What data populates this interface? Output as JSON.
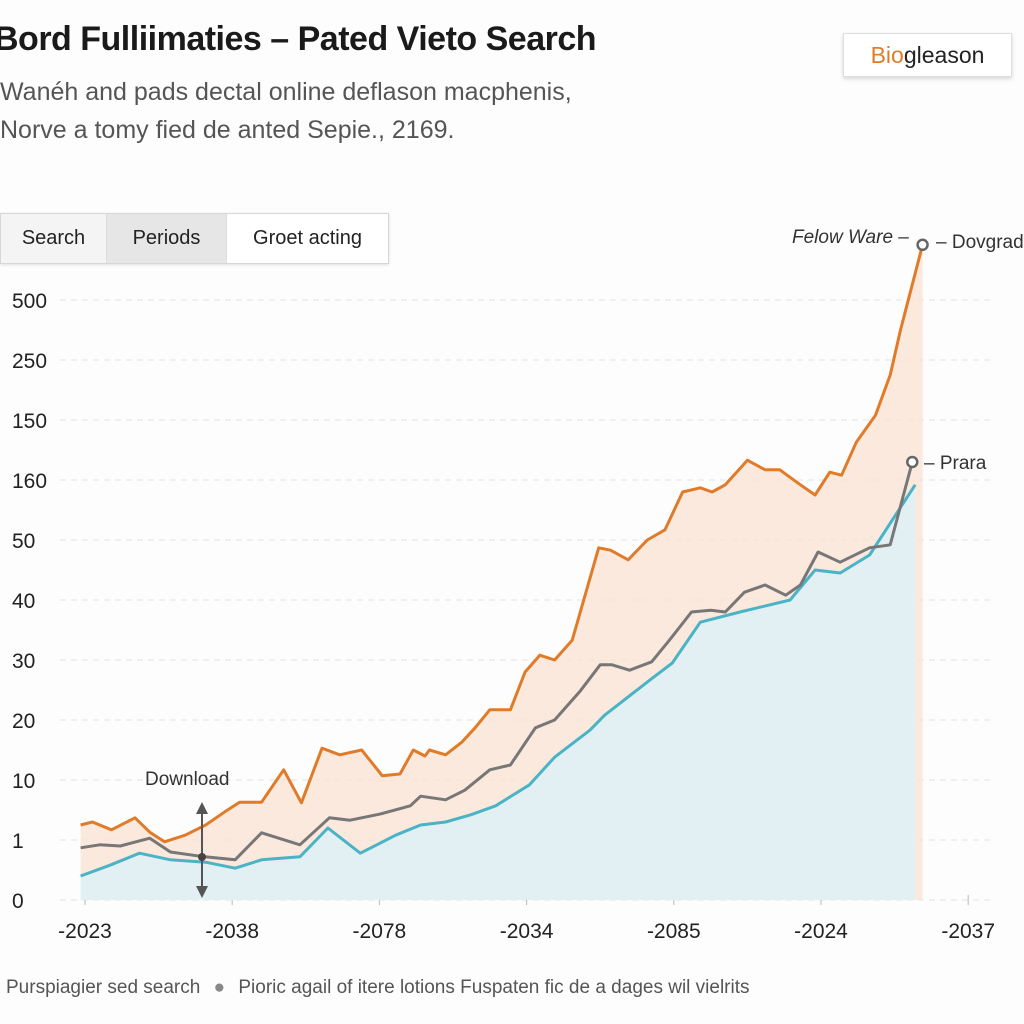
{
  "header": {
    "title": "Bord Fulliimaties – Pated Vieto Search",
    "subtitle_line1": "Wanéh and pads dectal online deflason macphenis,",
    "subtitle_line2": "Norve a tomy fied de anted Sepie., 2169.",
    "brand_prefix": "Bio",
    "brand_suffix": "gleason"
  },
  "toggles": [
    {
      "label": "Search"
    },
    {
      "label": "Periods",
      "active": true
    },
    {
      "label": "Groet acting"
    }
  ],
  "legend": {
    "item1": "Purspiagier sed search",
    "item2": "Pioric agail of itere lotions Fuspaten fic de a dages wil vielrits"
  },
  "annotations": {
    "top_left": "Felow Ware –",
    "top_right": "– Dovgrad",
    "mid": "– Prara",
    "download": "Download"
  },
  "colors": {
    "orange": "#e07b2a",
    "gray": "#777777",
    "teal": "#4ab3c6",
    "orange_fill": "#fbe3d4",
    "teal_fill": "#dff1f5"
  },
  "chart_data": {
    "type": "area",
    "title": "",
    "xlabel": "",
    "ylabel": "",
    "x_tick_labels": [
      "-2023",
      "-2038",
      "-2078",
      "-2034",
      "-2085",
      "-2024",
      "-2037"
    ],
    "y_tick_labels": [
      "0",
      "1",
      "10",
      "20",
      "30",
      "40",
      "50",
      "160",
      "150",
      "250",
      "500"
    ],
    "y_scale": "ordinal tick positions (0 = first label, 10 = last label)",
    "grid": true,
    "series": [
      {
        "color": "orange",
        "points": [
          [
            -0.03,
            1.25
          ],
          [
            0.05,
            1.3
          ],
          [
            0.18,
            1.17
          ],
          [
            0.34,
            1.37
          ],
          [
            0.44,
            1.13
          ],
          [
            0.54,
            0.97
          ],
          [
            0.68,
            1.08
          ],
          [
            0.82,
            1.25
          ],
          [
            0.95,
            1.47
          ],
          [
            1.05,
            1.63
          ],
          [
            1.2,
            1.63
          ],
          [
            1.35,
            2.17
          ],
          [
            1.47,
            1.62
          ],
          [
            1.61,
            2.53
          ],
          [
            1.73,
            2.42
          ],
          [
            1.88,
            2.5
          ],
          [
            2.02,
            2.07
          ],
          [
            2.14,
            2.1
          ],
          [
            2.23,
            2.5
          ],
          [
            2.31,
            2.4
          ],
          [
            2.34,
            2.5
          ],
          [
            2.45,
            2.42
          ],
          [
            2.56,
            2.63
          ],
          [
            2.65,
            2.87
          ],
          [
            2.75,
            3.17
          ],
          [
            2.89,
            3.17
          ],
          [
            2.99,
            3.8
          ],
          [
            3.09,
            4.08
          ],
          [
            3.19,
            4.0
          ],
          [
            3.31,
            4.33
          ],
          [
            3.49,
            5.87
          ],
          [
            3.57,
            5.83
          ],
          [
            3.69,
            5.67
          ],
          [
            3.82,
            6.0
          ],
          [
            3.94,
            6.17
          ],
          [
            4.06,
            6.8
          ],
          [
            4.18,
            6.87
          ],
          [
            4.26,
            6.8
          ],
          [
            4.35,
            6.92
          ],
          [
            4.5,
            7.33
          ],
          [
            4.62,
            7.17
          ],
          [
            4.72,
            7.17
          ],
          [
            4.86,
            6.92
          ],
          [
            4.96,
            6.75
          ],
          [
            5.06,
            7.13
          ],
          [
            5.14,
            7.08
          ],
          [
            5.24,
            7.63
          ],
          [
            5.37,
            8.08
          ],
          [
            5.47,
            8.75
          ],
          [
            5.54,
            9.5
          ],
          [
            5.69,
            10.92
          ]
        ]
      },
      {
        "color": "gray",
        "points": [
          [
            -0.03,
            0.87
          ],
          [
            0.1,
            0.92
          ],
          [
            0.24,
            0.9
          ],
          [
            0.44,
            1.03
          ],
          [
            0.58,
            0.8
          ],
          [
            0.78,
            0.73
          ],
          [
            1.02,
            0.67
          ],
          [
            1.2,
            1.12
          ],
          [
            1.46,
            0.92
          ],
          [
            1.66,
            1.37
          ],
          [
            1.8,
            1.33
          ],
          [
            2.0,
            1.43
          ],
          [
            2.21,
            1.57
          ],
          [
            2.28,
            1.73
          ],
          [
            2.45,
            1.67
          ],
          [
            2.58,
            1.83
          ],
          [
            2.75,
            2.17
          ],
          [
            2.89,
            2.25
          ],
          [
            3.06,
            2.87
          ],
          [
            3.19,
            3.0
          ],
          [
            3.36,
            3.47
          ],
          [
            3.5,
            3.92
          ],
          [
            3.58,
            3.92
          ],
          [
            3.7,
            3.83
          ],
          [
            3.85,
            3.97
          ],
          [
            3.97,
            4.33
          ],
          [
            4.12,
            4.8
          ],
          [
            4.25,
            4.83
          ],
          [
            4.35,
            4.8
          ],
          [
            4.48,
            5.13
          ],
          [
            4.62,
            5.25
          ],
          [
            4.76,
            5.08
          ],
          [
            4.86,
            5.25
          ],
          [
            4.98,
            5.8
          ],
          [
            5.13,
            5.63
          ],
          [
            5.33,
            5.87
          ],
          [
            5.47,
            5.92
          ],
          [
            5.62,
            7.3
          ]
        ]
      },
      {
        "color": "teal",
        "points": [
          [
            -0.03,
            0.4
          ],
          [
            0.17,
            0.58
          ],
          [
            0.37,
            0.78
          ],
          [
            0.58,
            0.67
          ],
          [
            0.82,
            0.63
          ],
          [
            1.02,
            0.53
          ],
          [
            1.2,
            0.67
          ],
          [
            1.46,
            0.72
          ],
          [
            1.65,
            1.2
          ],
          [
            1.87,
            0.78
          ],
          [
            2.11,
            1.08
          ],
          [
            2.28,
            1.25
          ],
          [
            2.45,
            1.3
          ],
          [
            2.62,
            1.42
          ],
          [
            2.79,
            1.57
          ],
          [
            3.02,
            1.92
          ],
          [
            3.19,
            2.38
          ],
          [
            3.43,
            2.83
          ],
          [
            3.53,
            3.08
          ],
          [
            3.84,
            3.67
          ],
          [
            3.99,
            3.95
          ],
          [
            4.18,
            4.63
          ],
          [
            4.45,
            4.8
          ],
          [
            4.79,
            5.0
          ],
          [
            4.96,
            5.5
          ],
          [
            5.13,
            5.45
          ],
          [
            5.33,
            5.75
          ],
          [
            5.64,
            6.92
          ]
        ]
      }
    ]
  }
}
